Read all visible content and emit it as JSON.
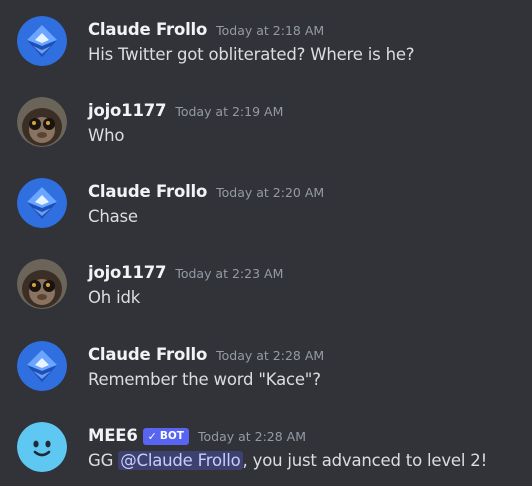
{
  "messages": [
    {
      "author": "Claude Frollo",
      "avatar": "blue-crystal-avatar",
      "timestamp": "Today at 2:18 AM",
      "text": "His Twitter got obliterated? Where is he?"
    },
    {
      "author": "jojo1177",
      "avatar": "monkey-photo-avatar",
      "timestamp": "Today at 2:19 AM",
      "text": "Who"
    },
    {
      "author": "Claude Frollo",
      "avatar": "blue-crystal-avatar",
      "timestamp": "Today at 2:20 AM",
      "text": "Chase"
    },
    {
      "author": "jojo1177",
      "avatar": "monkey-photo-avatar",
      "timestamp": "Today at 2:23 AM",
      "text": "Oh idk"
    },
    {
      "author": "Claude Frollo",
      "avatar": "blue-crystal-avatar",
      "timestamp": "Today at 2:28 AM",
      "text": "Remember the word \"Kace\"?"
    },
    {
      "author": "MEE6",
      "avatar": "mee6-smiley-avatar",
      "badge": "BOT",
      "badge_icon": "checkmark-icon",
      "timestamp": "Today at 2:28 AM",
      "text_before": "GG ",
      "mention": "@Claude Frollo",
      "text_after": ", you just advanced to level 2!"
    }
  ],
  "colors": {
    "background": "#313338",
    "username": "#f2f3f5",
    "timestamp": "#949ba4",
    "message_text": "#dbdee1",
    "bot_badge": "#5865f2",
    "mention_bg": "#3c4270",
    "mee6_avatar": "#5ec8f2"
  }
}
